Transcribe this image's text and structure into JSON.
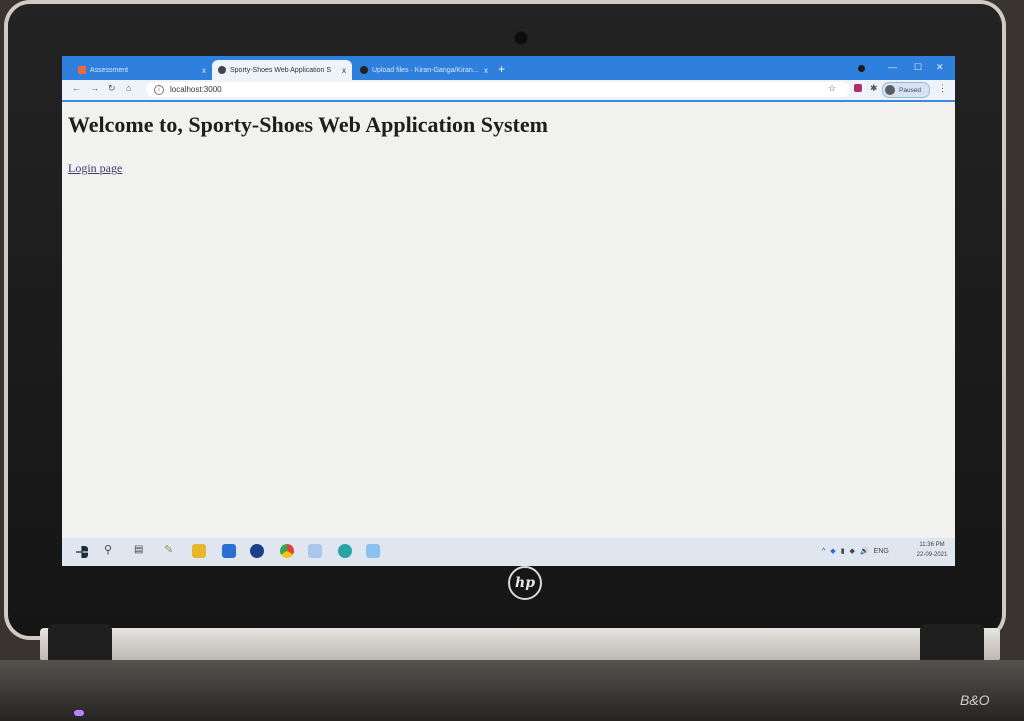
{
  "browser": {
    "tabs": [
      {
        "label": "Assessment"
      },
      {
        "label": "Sporty-Shoes Web Application S"
      },
      {
        "label": "Upload files · Kiran-Ganga/Kiran..."
      }
    ],
    "new_tab": "+",
    "close_glyph": "x",
    "address": "localhost:3000",
    "profile_label": "Paused"
  },
  "page": {
    "heading": "Welcome to, Sporty-Shoes Web Application System",
    "login_link": "Login page"
  },
  "taskbar": {
    "tray_lang": "ENG",
    "time": "11:36 PM",
    "date": "22-09-2021"
  },
  "device": {
    "brand": "hp"
  }
}
